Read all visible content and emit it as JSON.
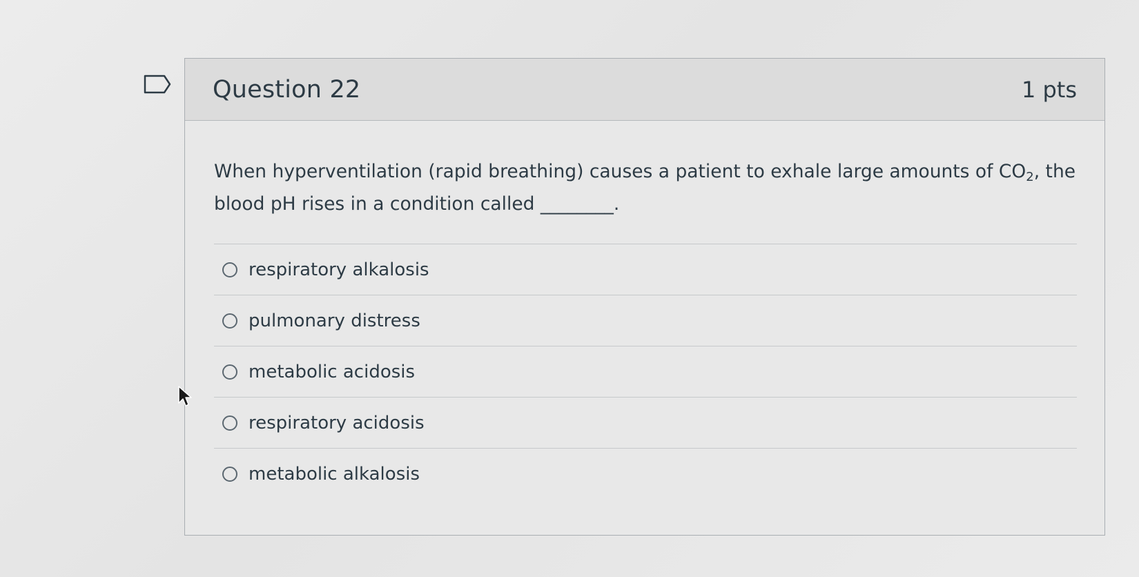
{
  "question": {
    "title": "Question 22",
    "points": "1 pts",
    "text_before": "When hyperventilation (rapid breathing) causes a patient to exhale large amounts of CO",
    "text_subscript": "2",
    "text_after": ", the blood pH rises in a condition called ________."
  },
  "answers": [
    {
      "label": "respiratory alkalosis",
      "selected": false
    },
    {
      "label": "pulmonary distress",
      "selected": false
    },
    {
      "label": "metabolic acidosis",
      "selected": false
    },
    {
      "label": "respiratory acidosis",
      "selected": false
    },
    {
      "label": "metabolic alkalosis",
      "selected": false
    }
  ],
  "icons": {
    "bookmark": "bookmark-flag-icon",
    "cursor": "mouse-pointer-icon"
  },
  "colors": {
    "text": "#2d3b45",
    "border": "#a9aeb2",
    "header_bg": "#dcdcdc"
  }
}
